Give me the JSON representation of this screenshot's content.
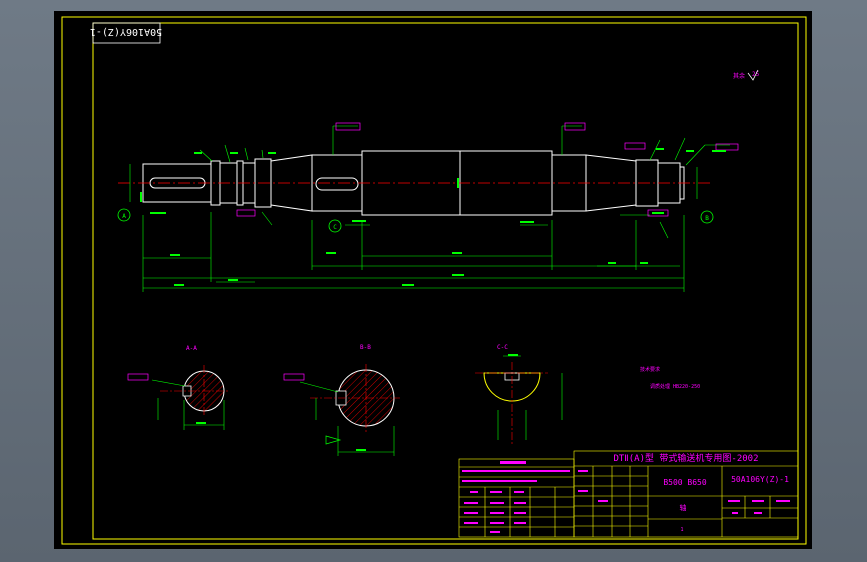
{
  "drawing": {
    "stamp_code": "50A106Y(Z)-1",
    "roughness_note": "其余",
    "roughness_value": "25",
    "section_a_label": "A-A",
    "section_b_label": "B-B",
    "section_c_label": "C-C",
    "datum_a": "A",
    "datum_b": "B",
    "datum_c": "C",
    "tech_req_title": "技术要求",
    "tech_req_line": "调质处理 HB220-250"
  },
  "title_block": {
    "header": "DTⅡ(A)型 带式输送机专用图-2002",
    "series": "B500 B650",
    "drawing_no": "50A106Y(Z)-1",
    "part_name": "轴",
    "sheet": "1"
  },
  "colors": {
    "background": "#000000",
    "frame": "#ffff00",
    "geometry": "#ffffff",
    "dimension": "#00ff00",
    "annotation": "#ff00ff",
    "centerline": "#ff0000"
  }
}
